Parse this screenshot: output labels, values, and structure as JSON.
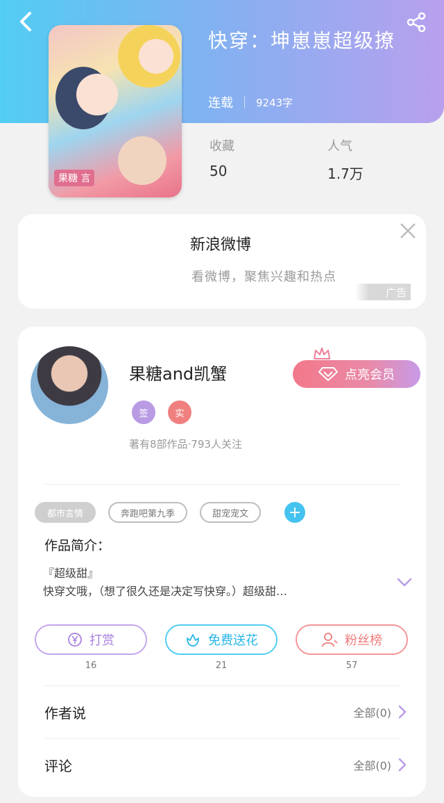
{
  "header": {
    "book_title": "快穿：坤崽崽超级撩",
    "status": "连载",
    "word_count": "9243字",
    "stats": [
      {
        "label": "收藏",
        "value": "50"
      },
      {
        "label": "人气",
        "value": "1.7万"
      }
    ],
    "colors": {
      "gradient_start": "#52cdf3",
      "gradient_end": "#b8a0ee"
    }
  },
  "cover": {
    "tag_text": "果糖 言"
  },
  "ad": {
    "title": "新浪微博",
    "subtitle": "看微博，聚焦兴趣和热点",
    "badge": "广告"
  },
  "author": {
    "name": "果糖and凯蟹",
    "badges": [
      "签",
      "实"
    ],
    "info": "著有8部作品·793人关注",
    "vip_button": "点亮会员"
  },
  "tags": [
    "都市言情",
    "奔跑吧第九季",
    "甜宠宠文"
  ],
  "intro": {
    "label": "作品简介：",
    "line1": "『超级甜』",
    "line2": "快穿文哦，（想了很久还是决定写快穿。）超级甜…"
  },
  "actions": [
    {
      "label": "打赏",
      "count": "16",
      "icon": "yen-icon"
    },
    {
      "label": "免费送花",
      "count": "21",
      "icon": "flower-icon"
    },
    {
      "label": "粉丝榜",
      "count": "57",
      "icon": "user-icon"
    }
  ],
  "rows": [
    {
      "label": "作者说",
      "right": "全部(0)"
    },
    {
      "label": "评论",
      "right": "全部(0)"
    }
  ]
}
